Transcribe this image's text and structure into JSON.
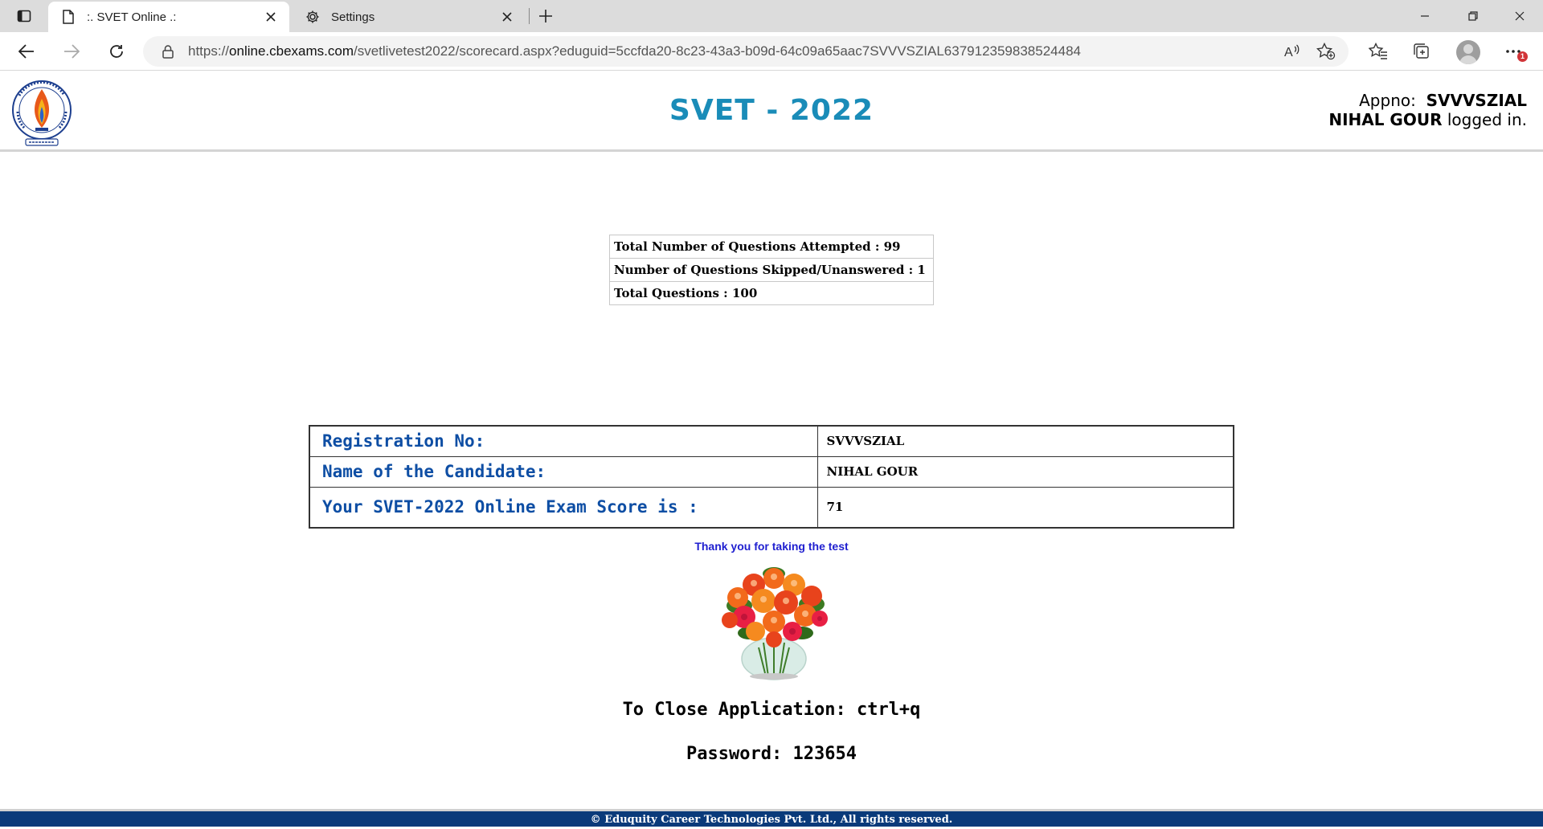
{
  "browser": {
    "tabs": [
      {
        "title": ":. SVET Online .:",
        "icon": "page-icon",
        "active": true
      },
      {
        "title": "Settings",
        "icon": "gear-icon",
        "active": false
      }
    ],
    "url_prefix": "https://",
    "url_host": "online.cbexams.com",
    "url_path": "/svetlivetest2022/scorecard.aspx?eduguid=5ccfda20-8c23-43a3-b09d-64c09a65aac7SVVVSZIAL637912359838524484",
    "notification_count": "1"
  },
  "header": {
    "title": "SVET - 2022",
    "appno_label": "Appno:",
    "appno_value": "SVVVSZIAL",
    "user_name": "NIHAL GOUR",
    "logged_in_text": "logged in."
  },
  "summary": {
    "attempted": "Total Number of Questions Attempted : 99",
    "skipped": "Number of Questions Skipped/Unanswered : 1",
    "total": "Total Questions : 100"
  },
  "scorecard": {
    "rows": [
      {
        "label": "Registration No:",
        "value": "SVVVSZIAL"
      },
      {
        "label": "Name of the Candidate:",
        "value": "NIHAL GOUR"
      },
      {
        "label": "Your SVET-2022 Online Exam Score is :",
        "value": "71"
      }
    ]
  },
  "thanks_text": "Thank you for taking the test",
  "close_info": "To Close Application: ctrl+q",
  "password_info": "Password: 123654",
  "footer": "© Eduquity Career Technologies Pvt. Ltd., All rights reserved.",
  "colors": {
    "title": "#1a8cb8",
    "label": "#0e4ea4",
    "thanks": "#2020d0",
    "footer_bg": "#0a3a7a"
  }
}
